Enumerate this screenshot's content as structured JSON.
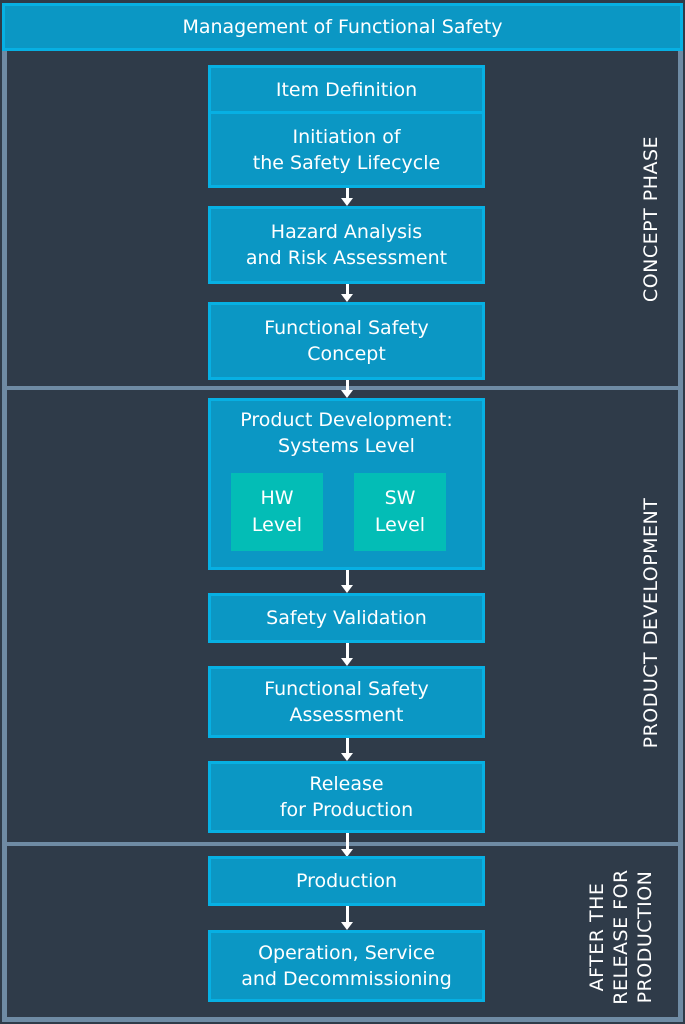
{
  "header": {
    "title": "Management of Functional Safety"
  },
  "phases": [
    {
      "label": "CONCEPT PHASE"
    },
    {
      "label": "PRODUCT DEVELOPMENT"
    },
    {
      "label": "AFTER THE\nRELEASE FOR\nPRODUCTION"
    }
  ],
  "steps": [
    {
      "label": "Item Definition"
    },
    {
      "label": "Initiation of\nthe Safety Lifecycle"
    },
    {
      "label": "Hazard Analysis\nand Risk Assessment"
    },
    {
      "label": "Functional Safety\nConcept"
    },
    {
      "label": "Product Development:\nSystems Level"
    },
    {
      "label": "Safety Validation"
    },
    {
      "label": "Functional Safety\nAssessment"
    },
    {
      "label": "Release\nfor Production"
    },
    {
      "label": "Production"
    },
    {
      "label": "Operation, Service\nand Decommissioning"
    }
  ],
  "sublevels": [
    {
      "label": "HW\nLevel"
    },
    {
      "label": "SW\nLevel"
    }
  ],
  "colors": {
    "background": "#2f3b49",
    "box_fill": "#0b97c4",
    "box_border": "#07b0e3",
    "sub_fill": "#03bdb6",
    "frame": "#6f8ba4"
  }
}
